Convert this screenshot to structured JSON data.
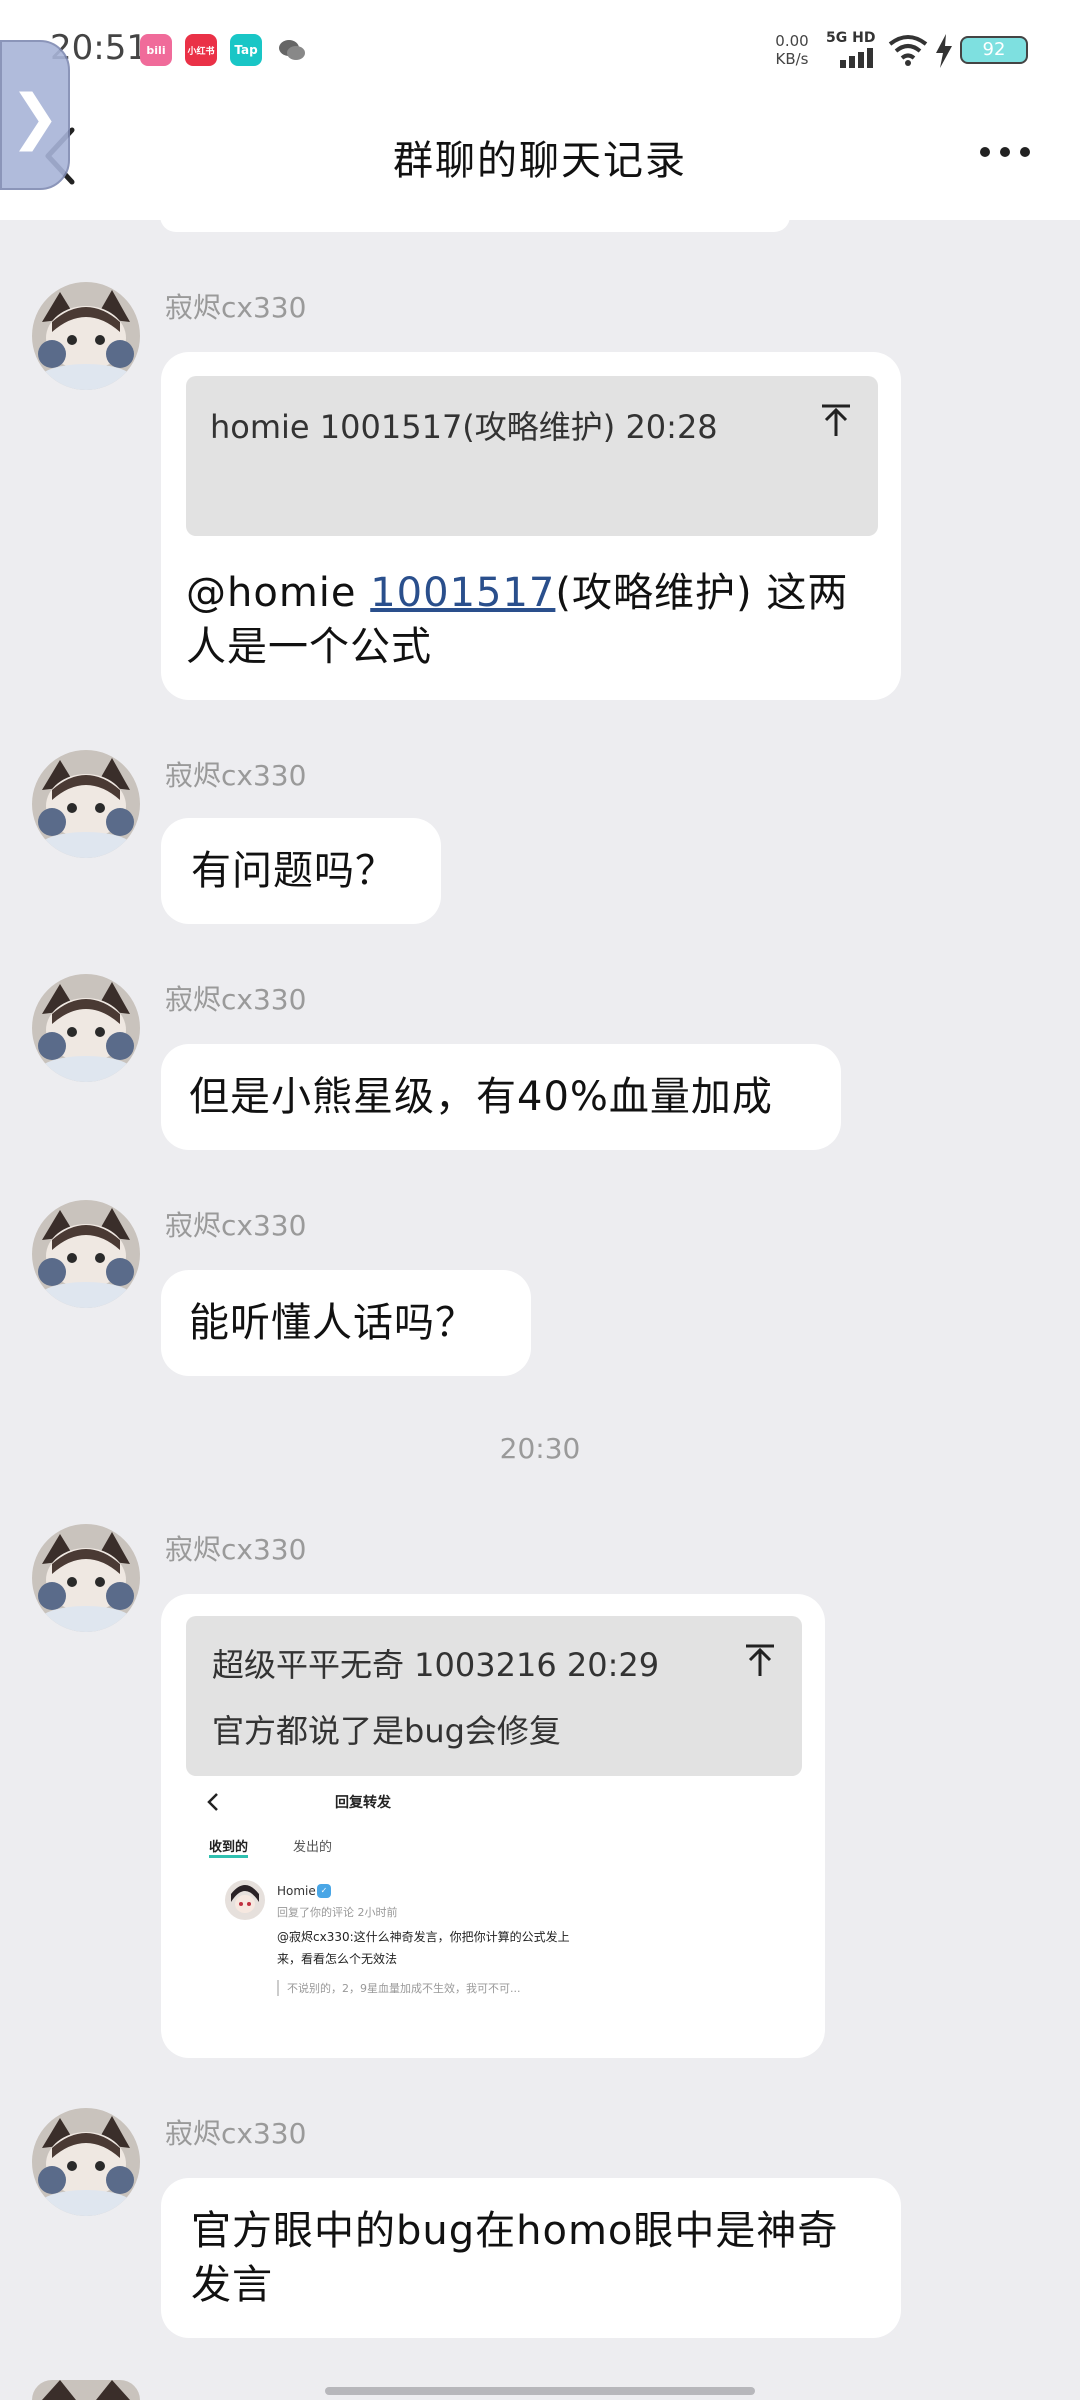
{
  "status_bar": {
    "time": "20:51",
    "apps": [
      {
        "name": "bilibili-icon",
        "text": "bili",
        "color": "#f06b9a"
      },
      {
        "name": "xiaohongshu-icon",
        "text": "小红书",
        "color": "#ea3147"
      },
      {
        "name": "taptap-icon",
        "text": "Tap",
        "color": "#19c6c6"
      },
      {
        "name": "wechat-icon",
        "text": "",
        "color": "#666666"
      }
    ],
    "net_speed_value": "0.00",
    "net_speed_unit": "KB/s",
    "signal_label": "5G HD",
    "battery": "92"
  },
  "header": {
    "title": "群聊的聊天记录"
  },
  "messages": [
    {
      "sender": "寂烬cx330",
      "quote": {
        "header": "homie 1001517(攻略维护) 20:28"
      },
      "text_prefix": "@homie ",
      "text_link": "1001517",
      "text_suffix": "(攻略维护) 这两人是一个公式"
    },
    {
      "sender": "寂烬cx330",
      "text": "有问题吗？"
    },
    {
      "sender": "寂烬cx330",
      "text": "但是小熊星级，有40%血量加成"
    },
    {
      "sender": "寂烬cx330",
      "text": "能听懂人话吗？"
    },
    {
      "sender": "寂烬cx330",
      "quote": {
        "header": "超级平平无奇 1003216 20:29",
        "body": "官方都说了是bug会修复"
      },
      "screenshot": {
        "title": "回复转发",
        "tab_received": "收到的",
        "tab_sent": "发出的",
        "name": "Homie",
        "sub": "回复了你的评论 2小时前",
        "body": "@寂烬cx330:这什么神奇发言，你把你计算的公式发上来，看看怎么个无效法",
        "quote": "不说别的，2，9星血量加成不生效，我可不可..."
      }
    },
    {
      "sender": "寂烬cx330",
      "text": "官方眼中的bug在homo眼中是神奇发言"
    }
  ],
  "timestamp_divider": "20:30"
}
